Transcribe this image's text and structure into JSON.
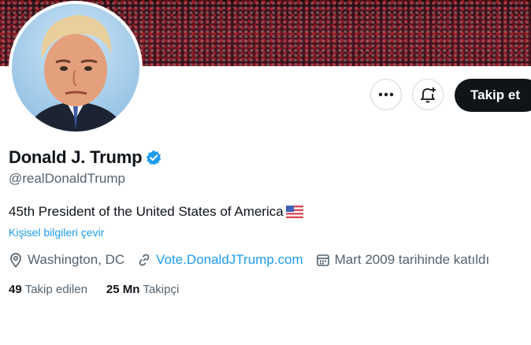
{
  "profile": {
    "name": "Donald J. Trump",
    "handle": "@realDonaldTrump",
    "bio": "45th President of the United States of America",
    "bio_flag": "us-flag-emoji",
    "translate_label": "Kişisel bilgileri çevir",
    "location": "Washington, DC",
    "website": "Vote.DonaldJTrump.com",
    "joined": "Mart 2009 tarihinde katıldı",
    "following_count": "49",
    "following_label": "Takip edilen",
    "followers_count": "25 Mn",
    "followers_label": "Takipçi"
  },
  "actions": {
    "follow_label": "Takip et",
    "more_icon": "more-dots-icon",
    "notify_icon": "bell-plus-icon"
  },
  "colors": {
    "accent": "#1d9bf0",
    "text": "#0f1419",
    "muted": "#536471",
    "follow_bg": "#0f1419"
  }
}
